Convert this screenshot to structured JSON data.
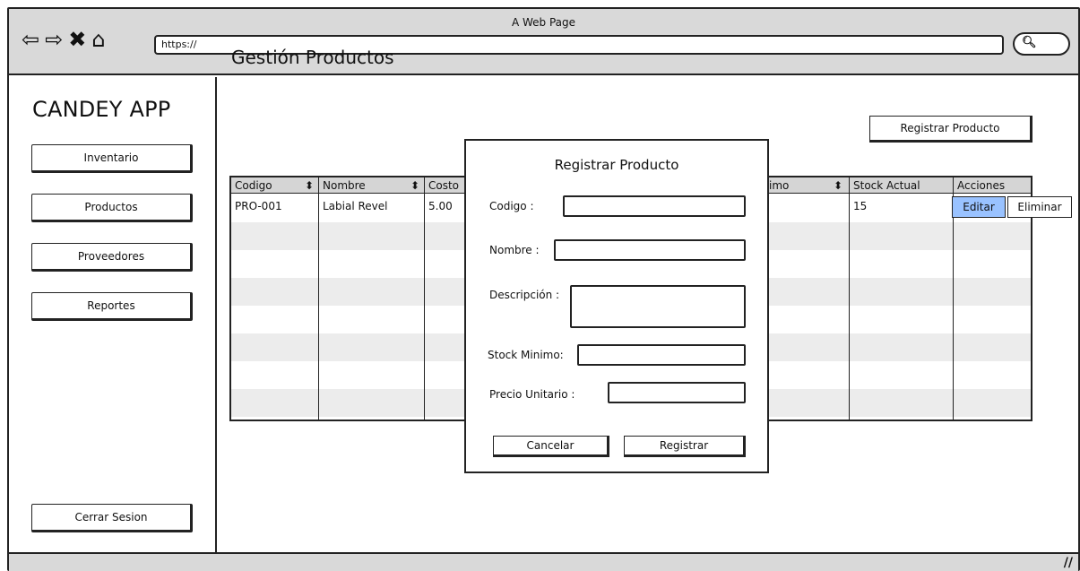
{
  "window": {
    "title": "A Web Page",
    "url": "https://",
    "nav_icons": [
      "back-arrow-icon",
      "forward-arrow-icon",
      "close-x-icon",
      "home-icon"
    ],
    "search_icon": "search-icon"
  },
  "sidebar": {
    "app_title": "CANDEY APP",
    "items": [
      {
        "label": "Inventario"
      },
      {
        "label": "Productos"
      },
      {
        "label": "Proveedores"
      },
      {
        "label": "Reportes"
      }
    ],
    "logout_label": "Cerrar Sesion"
  },
  "main": {
    "page_title": "Gestión Productos",
    "register_button_label": "Registrar Producto",
    "table": {
      "columns": [
        "Codigo",
        "Nombre",
        "Costo",
        "imo",
        "Stock Actual",
        "Acciones"
      ],
      "rows": [
        {
          "codigo": "PRO-001",
          "nombre": "Labial Revel",
          "costo": "5.00",
          "stock_actual": "15"
        }
      ],
      "actions": {
        "edit": "Editar",
        "delete": "Eliminar"
      }
    }
  },
  "modal": {
    "title": "Registrar Producto",
    "fields": [
      {
        "label": "Codigo :"
      },
      {
        "label": "Nombre :"
      },
      {
        "label": "Descripción :"
      },
      {
        "label": "Stock Minimo:"
      },
      {
        "label": "Precio Unitario :"
      }
    ],
    "cancel_label": "Cancelar",
    "submit_label": "Registrar"
  },
  "colors": {
    "chrome": "#d9d9d9",
    "header": "#d5d5d5",
    "alt_row": "#ececec",
    "accent": "#99c2ff"
  }
}
